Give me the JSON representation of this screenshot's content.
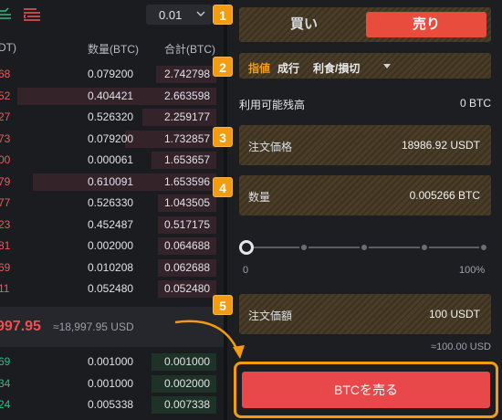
{
  "toolbar": {
    "precision": "0.01"
  },
  "book_header": {
    "price": "DT)",
    "qty": "数量(BTC)",
    "total": "合計(BTC)"
  },
  "asks": [
    {
      "price": "68",
      "qty": "0.079200",
      "total": "2.742798",
      "depth": 0.28
    },
    {
      "price": "52",
      "qty": "0.404421",
      "total": "2.663598",
      "depth": 0.92
    },
    {
      "price": "27",
      "qty": "0.526320",
      "total": "2.259177",
      "depth": 0.34
    },
    {
      "price": "73",
      "qty": "0.079200",
      "total": "1.732857",
      "depth": 0.42
    },
    {
      "price": "00",
      "qty": "0.000061",
      "total": "1.653657",
      "depth": 0.3
    },
    {
      "price": "79",
      "qty": "0.610091",
      "total": "1.653596",
      "depth": 0.85
    },
    {
      "price": "77",
      "qty": "0.526330",
      "total": "1.043505",
      "depth": 0.27
    },
    {
      "price": "23",
      "qty": "0.452487",
      "total": "0.517175",
      "depth": 0.27
    },
    {
      "price": "81",
      "qty": "0.002000",
      "total": "0.064688",
      "depth": 0.27
    },
    {
      "price": "69",
      "qty": "0.010208",
      "total": "0.062688",
      "depth": 0.27
    },
    {
      "price": "11",
      "qty": "0.052480",
      "total": "0.052480",
      "depth": 0.27
    }
  ],
  "last_price": {
    "price": "997.95",
    "ref": "≈18,997.95 USD"
  },
  "bids": [
    {
      "price": "69",
      "qty": "0.001000",
      "total": "0.001000",
      "depth": 0.3
    },
    {
      "price": "34",
      "qty": "0.001000",
      "total": "0.002000",
      "depth": 0.3
    },
    {
      "price": "24",
      "qty": "0.005338",
      "total": "0.007338",
      "depth": 0.3
    }
  ],
  "form": {
    "buy_label": "買い",
    "sell_label": "売り",
    "order_types": {
      "limit": "指値",
      "market": "成行",
      "stop": "利食/損切"
    },
    "available_label": "利用可能残高",
    "available_value": "0 BTC",
    "price_label": "注文価格",
    "price_value": "18986.92 USDT",
    "qty_label": "数量",
    "qty_value": "0.005266 BTC",
    "slider_min": "0",
    "slider_max": "100%",
    "slider_value": 0,
    "total_label": "注文価額",
    "total_value": "100 USDT",
    "total_approx": "≈100.00 USD",
    "submit_label": "BTCを売る"
  },
  "badges": [
    "1",
    "2",
    "3",
    "4",
    "5"
  ],
  "colors": {
    "ask": "#ef5a5a",
    "bid": "#2ebd85",
    "accent": "#f39c12",
    "sell": "#e74c3c"
  }
}
